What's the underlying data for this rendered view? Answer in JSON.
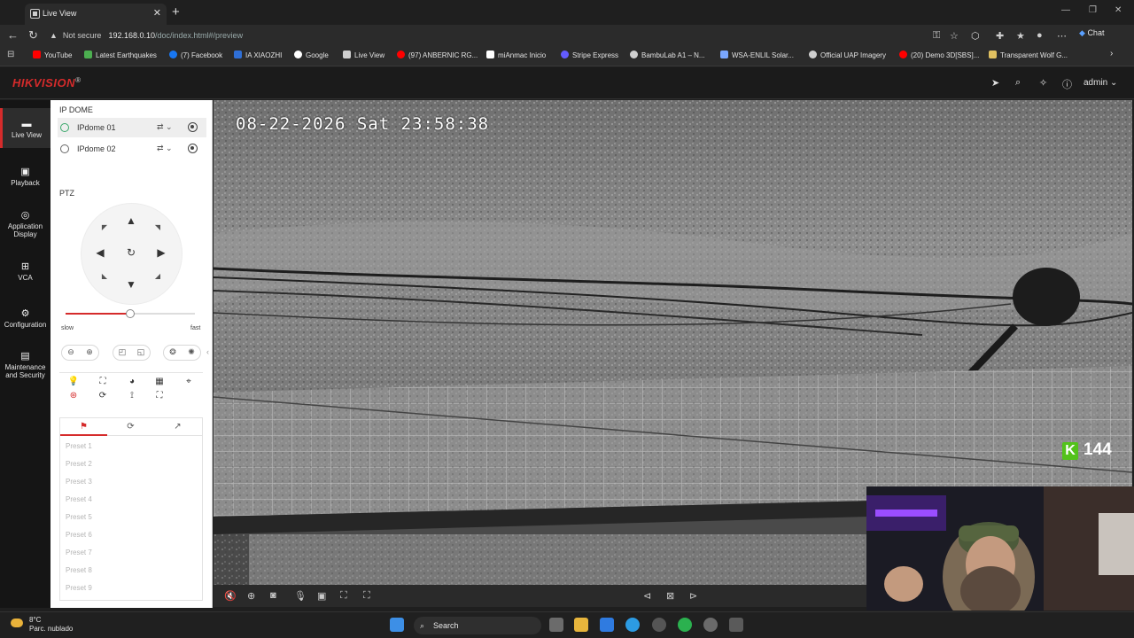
{
  "browser": {
    "tab_title": "Live View",
    "new_tab": "+",
    "url_warning": "Not secure",
    "url_host": "192.168.0.10",
    "url_path": "/doc/index.html#/preview",
    "chat_label": "Chat",
    "bookmarks": [
      {
        "label": "YouTube",
        "color": "#ff0000"
      },
      {
        "label": "Latest Earthquakes",
        "color": "#4caf50"
      },
      {
        "label": "(7) Facebook",
        "color": "#1877f2"
      },
      {
        "label": "IA XIAOZHI",
        "color": "#2f6fd6"
      },
      {
        "label": "Google",
        "color": "#ffffff"
      },
      {
        "label": "Live View",
        "color": "#cfcfcf"
      },
      {
        "label": "(97) ANBERNIC RG...",
        "color": "#ff0000"
      },
      {
        "label": "miAnmac Inicio",
        "color": "#ffffff"
      },
      {
        "label": "Stripe Express",
        "color": "#635bff"
      },
      {
        "label": "BambuLab A1 – N...",
        "color": "#cfcfcf"
      },
      {
        "label": "WSA-ENLIL Solar...",
        "color": "#7aa7ff"
      },
      {
        "label": "Official UAP Imagery",
        "color": "#cfcfcf"
      },
      {
        "label": "(20) Demo 3D[SBS]...",
        "color": "#ff0000"
      },
      {
        "label": "Transparent Wolf G...",
        "color": "#e0c060"
      }
    ]
  },
  "header": {
    "brand": "HIKVISION",
    "brand_mark": "®",
    "user": "admin"
  },
  "nav": [
    {
      "label": "Live View",
      "active": true
    },
    {
      "label": "Playback"
    },
    {
      "label": "Application Display"
    },
    {
      "label": "VCA"
    },
    {
      "label": "Configuration"
    },
    {
      "label": "Maintenance and Security"
    }
  ],
  "panel": {
    "section_title": "IP DOME",
    "cameras": [
      {
        "name": "IPdome 01",
        "selected": true
      },
      {
        "name": "IPdome 02",
        "selected": false
      }
    ],
    "ptz_title": "PTZ",
    "speed_slow": "slow",
    "speed_fast": "fast",
    "speed_level": 0.5,
    "preset_tabs": [
      "preset-flag",
      "patrol",
      "pattern"
    ],
    "presets": [
      "Preset 1",
      "Preset 2",
      "Preset 3",
      "Preset 4",
      "Preset 5",
      "Preset 6",
      "Preset 7",
      "Preset 8",
      "Preset 9"
    ]
  },
  "video": {
    "osd_timestamp": "08-22-2026 Sat 23:58:38",
    "badge_value": "144"
  },
  "taskbar": {
    "temp": "8°C",
    "weather": "Parc. nublado",
    "search_placeholder": "Search"
  }
}
